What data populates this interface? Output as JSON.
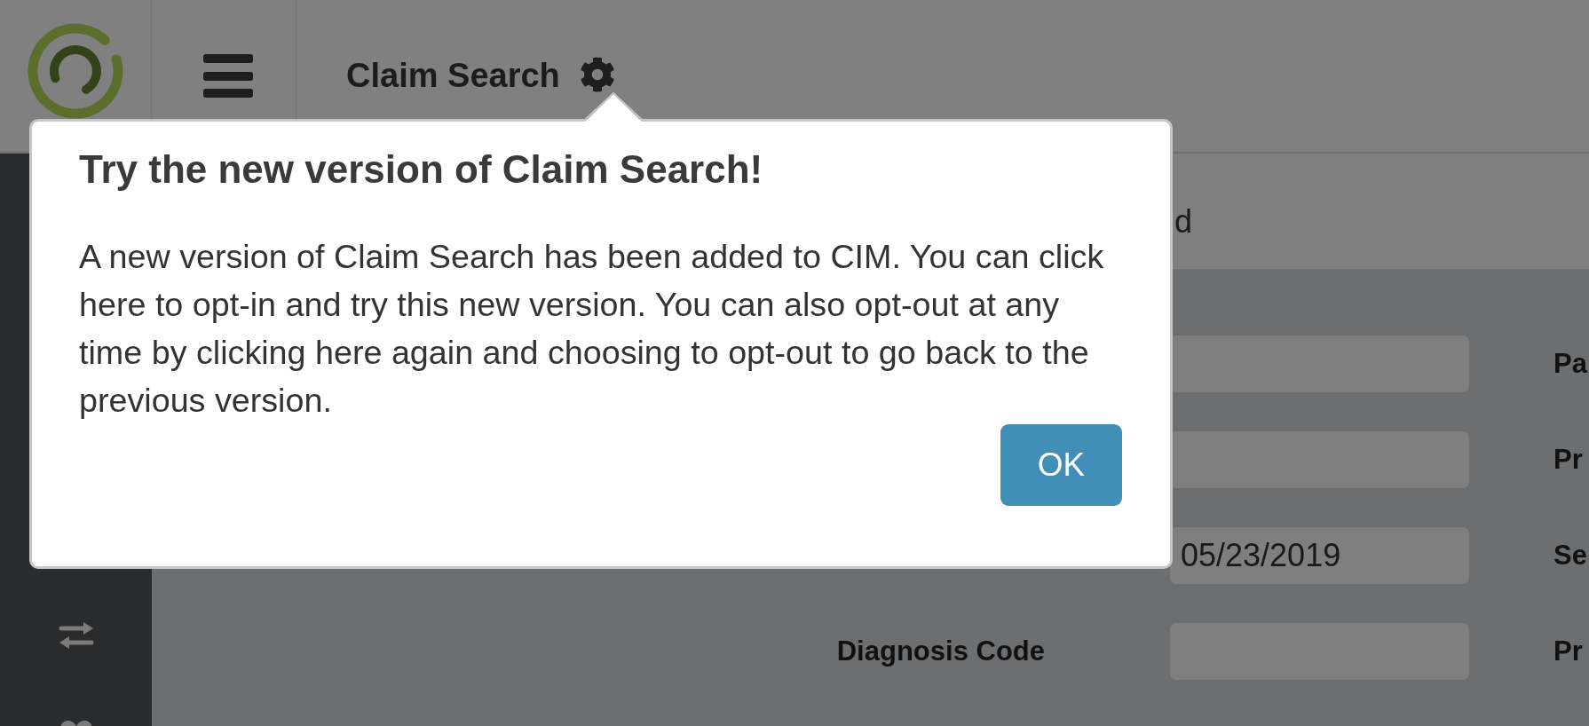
{
  "header": {
    "title": "Claim Search"
  },
  "tabs": [
    {
      "label": "d"
    }
  ],
  "form": {
    "rows": [
      {
        "next_label": "Pa"
      },
      {
        "next_label": "Pr"
      },
      {
        "value": "05/23/2019",
        "next_label": "Se"
      },
      {
        "label": "Diagnosis Code",
        "next_label": "Pr"
      }
    ]
  },
  "dialog": {
    "title": "Try the new version of Claim Search!",
    "message": "A new version of Claim Search has been added to CIM. You can click here to opt-in and try this new version. You can also opt-out at any time by clicking here again and choosing to opt-out to go back to the previous version.",
    "button": "OK"
  }
}
